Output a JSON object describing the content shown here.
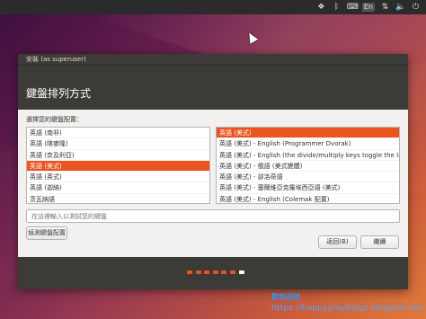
{
  "panel": {
    "icons": [
      "dropbox-icon",
      "bluetooth-icon",
      "keyboard-layout-icon",
      "network-icon",
      "volume-icon",
      "power-icon"
    ],
    "language_indicator": "En"
  },
  "window": {
    "title": "安裝 (as superuser)",
    "heading": "鍵盤排列方式",
    "prompt": "選擇您的鍵盤配置：",
    "layouts": [
      "英語 (南非)",
      "英語 (喀麥隆)",
      "英語 (奈及利亞)",
      "英語 (美式)",
      "英語 (英式)",
      "英語 (迦納)",
      "茨瓦納語"
    ],
    "selected_layout_index": 3,
    "variants": [
      "英語 (美式)",
      "英語 (美式) - English (Programmer Dvorak)",
      "英語 (美式) - English (the divide/multiply keys toggle the layout)",
      "英語 (美式) - 俄語 (美式變體)",
      "英語 (美式) - 卻洛奇語",
      "英語 (美式) - 塞爾維亞克羅埃西亞語 (美式)",
      "英語 (美式) - English (Colemak 配置)"
    ],
    "selected_variant_index": 0,
    "test_placeholder": "在這裡輸入以測試您的鍵盤",
    "detect_button": "偵測鍵盤配置",
    "back_button": "返回(B)",
    "continue_button": "繼續",
    "progress": {
      "total_steps": 7,
      "current_step": 7
    }
  },
  "watermark": {
    "line1": "歡樂過號",
    "line2": "https://happyplayblogs.blogspot.tw/"
  },
  "colors": {
    "accent": "#e95420",
    "header_bg": "#3c3b37",
    "window_bg": "#f2f1f0"
  }
}
